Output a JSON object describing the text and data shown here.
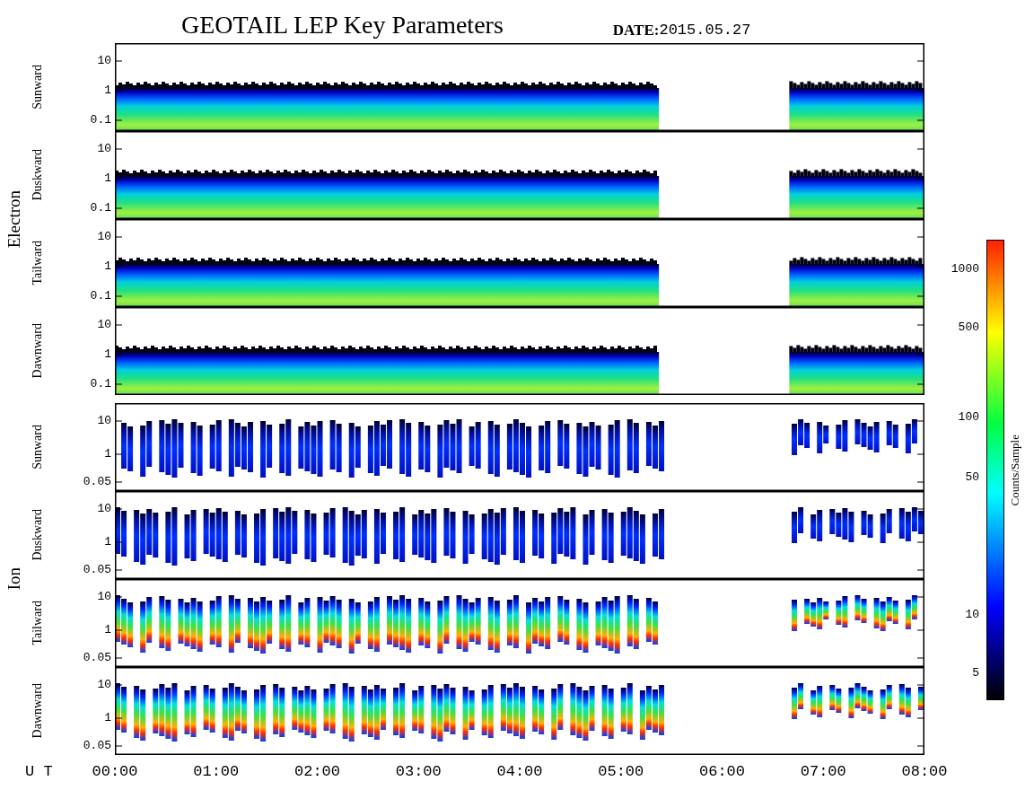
{
  "title": "GEOTAIL LEP Key Parameters",
  "date_label": "DATE:",
  "date": "2015.05.27",
  "groups": [
    {
      "name": "Electron",
      "kind": "electron",
      "panels": [
        {
          "name": "Sunward",
          "yticks": [
            "10",
            "1",
            "0.1"
          ]
        },
        {
          "name": "Duskward",
          "yticks": [
            "10",
            "1",
            "0.1"
          ]
        },
        {
          "name": "Tailward",
          "yticks": [
            "10",
            "1",
            "0.1"
          ]
        },
        {
          "name": "Dawnward",
          "yticks": [
            "10",
            "1",
            "0.1"
          ]
        }
      ]
    },
    {
      "name": "Ion",
      "kind": "ion",
      "panels": [
        {
          "name": "Sunward",
          "yticks": [
            "10",
            "1",
            "0.05"
          ]
        },
        {
          "name": "Duskward",
          "yticks": [
            "10",
            "1",
            "0.05"
          ]
        },
        {
          "name": "Tailward",
          "yticks": [
            "10",
            "1",
            "0.05"
          ]
        },
        {
          "name": "Dawnward",
          "yticks": [
            "10",
            "1",
            "0.05"
          ]
        }
      ]
    }
  ],
  "colorbar": {
    "label": "Counts/Sample",
    "ticks": [
      "1000",
      "500",
      "100",
      "50",
      "10",
      "5"
    ]
  },
  "x_axis": {
    "label": "U T",
    "ticks": [
      "00:00",
      "01:00",
      "02:00",
      "03:00",
      "04:00",
      "05:00",
      "06:00",
      "07:00",
      "08:00"
    ]
  }
}
